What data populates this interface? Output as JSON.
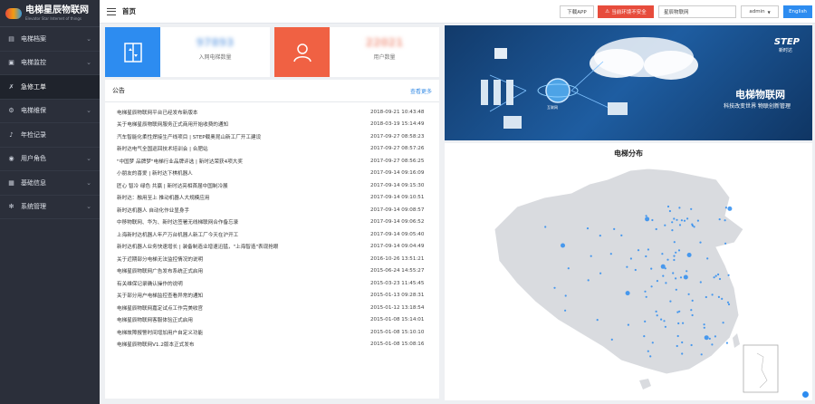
{
  "app": {
    "logo_title": "电梯星辰物联网",
    "logo_subtitle": "Elevator Star Internet of things"
  },
  "sidebar": {
    "items": [
      {
        "label": "电梯档案",
        "icon": "archive-icon",
        "expandable": true
      },
      {
        "label": "电梯监控",
        "icon": "monitor-icon",
        "expandable": true
      },
      {
        "label": "急修工单",
        "icon": "wrench-icon",
        "expandable": false,
        "active": true
      },
      {
        "label": "电梯维保",
        "icon": "maintenance-icon",
        "expandable": true
      },
      {
        "label": "年检记录",
        "icon": "bell-icon",
        "expandable": false
      },
      {
        "label": "用户角色",
        "icon": "user-icon",
        "expandable": true
      },
      {
        "label": "基础信息",
        "icon": "info-icon",
        "expandable": true
      },
      {
        "label": "系统管理",
        "icon": "gear-icon",
        "expandable": true
      }
    ]
  },
  "header": {
    "title": "首页",
    "download_app": "下载APP",
    "env_warning": "当前环境不安全",
    "search_placeholder": "星辰物联网",
    "user": "admin",
    "language": "English"
  },
  "stats": [
    {
      "value": "97893",
      "label": "入网电梯数量",
      "color": "#2d8cf0"
    },
    {
      "value": "22021",
      "label": "用户数量",
      "color": "#f06143"
    }
  ],
  "notice": {
    "title": "公告",
    "more": "查看更多",
    "rows": [
      {
        "title": "电梯星辰物联网平台已经发布新版本",
        "date": "2018-09-21 10:43:48"
      },
      {
        "title": "关于电梯星辰物联网服务正式商用开始收费的通知",
        "date": "2018-03-19 15:14:49"
      },
      {
        "title": "汽车智能化柔性焊接生产线项目 | STEP载奥昆山新工厂开工建设",
        "date": "2017-09-27 08:58:23"
      },
      {
        "title": "新时达电气全国巡回技术培训会 | 合肥站",
        "date": "2017-09-27 08:57:26"
      },
      {
        "title": "\"中国梦 品牌梦\"电梯行业品牌评选 | 新时达荣获4项大奖",
        "date": "2017-09-27 08:56:25"
      },
      {
        "title": "小朋友的喜爱 | 新时达下棋机器人",
        "date": "2017-09-14 09:16:09"
      },
      {
        "title": "匠心 智冷 绿色 共赢 | 新时达亮相首届中国制冷展",
        "date": "2017-09-14 09:15:30"
      },
      {
        "title": "新时达：融用至上 推动机器人大规模应用",
        "date": "2017-09-14 09:10:51"
      },
      {
        "title": "新时达机器人 自动化作业显身手",
        "date": "2017-09-14 09:08:57"
      },
      {
        "title": "中移物联网、华为、新时达签署无线梯联网合作备忘录",
        "date": "2017-09-14 09:06:52"
      },
      {
        "title": "上海新时达机器人年产万台机器人新工厂今天在沪开工",
        "date": "2017-09-14 09:05:40"
      },
      {
        "title": "新时达机器人业务快速增长 | 装备制造业增速迅猛，\"上海智造\"表现抢眼",
        "date": "2017-09-14 09:04:49"
      },
      {
        "title": "关于近期部分电梯无法监控情况的说明",
        "date": "2016-10-26 13:51:21"
      },
      {
        "title": "电梯星辰物联网广告发布系统正式启用",
        "date": "2015-06-24 14:55:27"
      },
      {
        "title": "有关维保记录确认操作的说明",
        "date": "2015-03-23 11:45:45"
      },
      {
        "title": "关于部分用户电梯监控查看异常的通知",
        "date": "2015-01-13 09:28:31"
      },
      {
        "title": "电梯星辰物联网嘉定试点工作完美收官",
        "date": "2015-01-12 13:18:54"
      },
      {
        "title": "电梯星辰物联网客服体验正式启用",
        "date": "2015-01-08 15:14:01"
      },
      {
        "title": "电梯故障报警时间增加用户自定义功能",
        "date": "2015-01-08 15:10:10"
      },
      {
        "title": "电梯星辰物联网V1.2版本正式发布",
        "date": "2015-01-08 15:08:16"
      }
    ]
  },
  "banner": {
    "brand": "STEP",
    "brand_cn": "新时达",
    "title": "电梯物联网",
    "slogan": "科技改变世界 物联创新管理",
    "center_label": "互联网"
  },
  "map": {
    "title": "电梯分布",
    "dot_color": "#2d8cf0",
    "region_color": "#d9dbdf"
  }
}
